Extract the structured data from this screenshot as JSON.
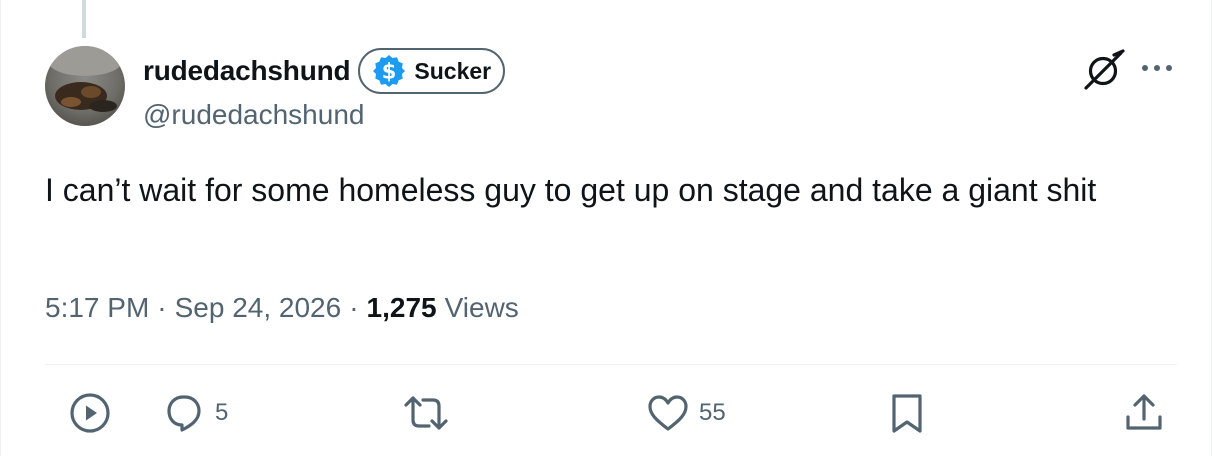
{
  "author": {
    "display_name": "rudedachshund",
    "handle": "@rudedachshund",
    "badge": {
      "label": "Sucker",
      "icon": "dollar-coin-icon",
      "icon_color": "#1d9bf0"
    }
  },
  "tweet": {
    "text": "I can’t wait for some homeless guy to get up on stage and take a giant shit",
    "time": "5:17 PM",
    "separator": "·",
    "date": "Sep 24, 2026",
    "views_count": "1,275",
    "views_label": "Views"
  },
  "actions": {
    "view_analytics": {
      "icon": "play-circle-icon"
    },
    "reply": {
      "icon": "reply-bubble-icon",
      "count": "5"
    },
    "repost": {
      "icon": "repost-icon"
    },
    "like": {
      "icon": "heart-icon",
      "count": "55"
    },
    "bookmark": {
      "icon": "bookmark-icon"
    },
    "share": {
      "icon": "share-icon"
    }
  },
  "header_icons": {
    "grok": "grok-icon",
    "more": "more-options-icon"
  },
  "colors": {
    "text_primary": "#0f1419",
    "text_secondary": "#536471",
    "divider": "#eff3f4",
    "accent": "#1d9bf0"
  }
}
